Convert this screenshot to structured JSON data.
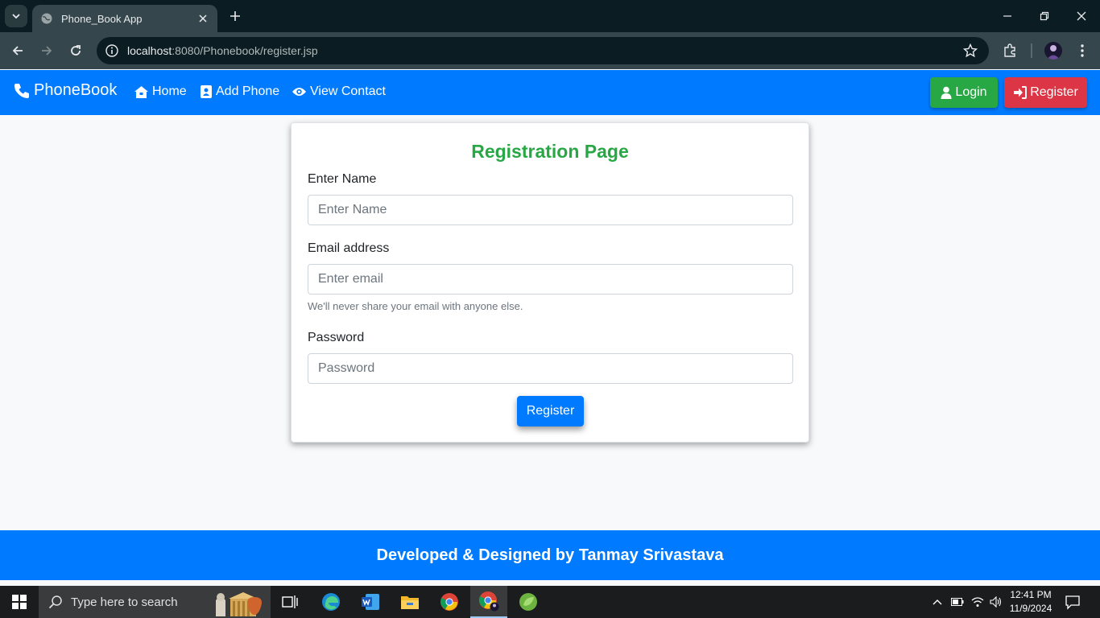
{
  "browser": {
    "tab_title": "Phone_Book App",
    "url_host": "localhost",
    "url_rest": ":8080/Phonebook/register.jsp"
  },
  "navbar": {
    "brand": "PhoneBook",
    "links": [
      {
        "label": "Home",
        "icon": "home-icon"
      },
      {
        "label": "Add Phone",
        "icon": "address-book-icon"
      },
      {
        "label": "View Contact",
        "icon": "eye-icon"
      }
    ],
    "login_label": "Login",
    "register_label": "Register",
    "colors": {
      "navbar": "#007bff",
      "login": "#28a745",
      "register": "#dc3545"
    }
  },
  "form": {
    "title": "Registration Page",
    "name_label": "Enter Name",
    "name_placeholder": "Enter Name",
    "email_label": "Email address",
    "email_placeholder": "Enter email",
    "email_help": "We'll never share your email with anyone else.",
    "password_label": "Password",
    "password_placeholder": "Password",
    "submit_label": "Register",
    "title_color": "#28a745"
  },
  "footer": {
    "text": "Developed & Designed by Tanmay Srivastava"
  },
  "taskbar": {
    "search_placeholder": "Type here to search",
    "time": "12:41 PM",
    "date": "11/9/2024"
  }
}
